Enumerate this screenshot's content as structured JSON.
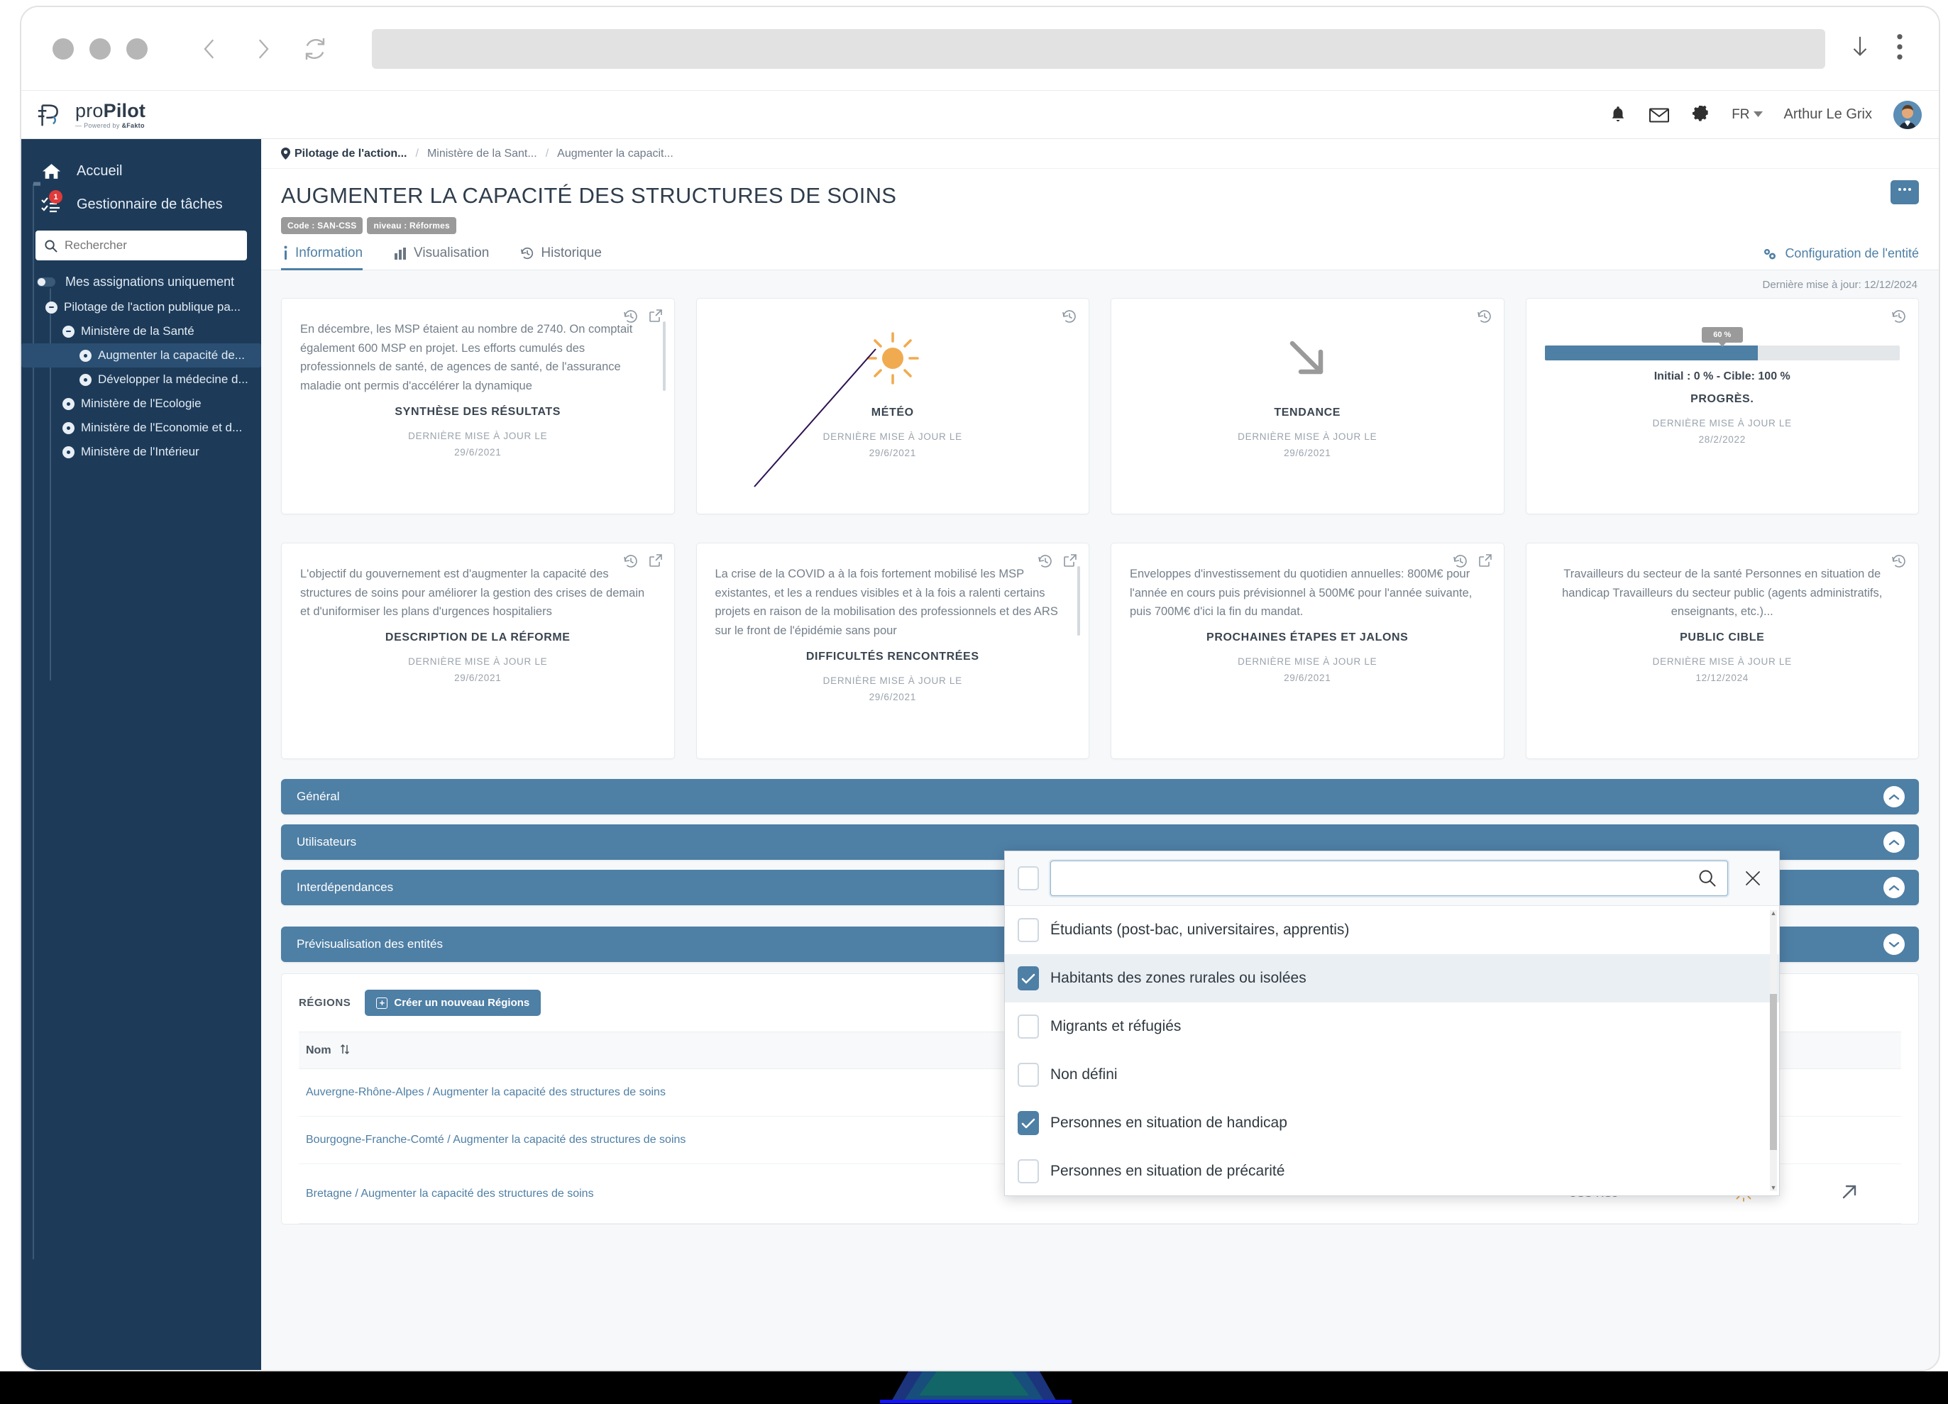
{
  "browser": {
    "back_icon": "chevron-left-icon",
    "forward_icon": "chevron-right-icon",
    "reload_icon": "reload-icon",
    "download_icon": "download-arrow-icon",
    "menu_icon": "kebab-menu-icon",
    "url_value": ""
  },
  "app_header": {
    "logo_title_light": "pro",
    "logo_title_bold": "Pilot",
    "logo_subtitle_pre": "— Powered by ",
    "logo_subtitle_bold": "&Fakto",
    "bell_icon": "bell-icon",
    "mail_icon": "mail-icon",
    "gear_icon": "gear-icon",
    "language": "FR",
    "user_name": "Arthur Le Grix"
  },
  "sidebar": {
    "home_label": "Accueil",
    "tasks_label": "Gestionnaire de tâches",
    "tasks_badge": "1",
    "search_placeholder": "Rechercher",
    "search_value": "",
    "toggle_label": "Mes assignations uniquement",
    "tree": [
      {
        "label": "Pilotage de l'action publique pa...",
        "level": 1,
        "expanded": true,
        "active": false
      },
      {
        "label": "Ministère de la Santé",
        "level": 2,
        "expanded": true,
        "active": false
      },
      {
        "label": "Augmenter la capacité de...",
        "level": 3,
        "expanded": false,
        "active": true
      },
      {
        "label": "Développer la médecine d...",
        "level": 3,
        "expanded": false,
        "active": false
      },
      {
        "label": "Ministère de l'Ecologie",
        "level": 2,
        "expanded": false,
        "active": false
      },
      {
        "label": "Ministère de l'Economie et d...",
        "level": 2,
        "expanded": false,
        "active": false
      },
      {
        "label": "Ministère de l'Intérieur",
        "level": 2,
        "expanded": false,
        "active": false
      }
    ]
  },
  "breadcrumb": {
    "pin_icon": "location-pin-icon",
    "items": [
      "Pilotage de l'action...",
      "Ministère de la Sant...",
      "Augmenter la capacit..."
    ]
  },
  "page": {
    "title": "AUGMENTER LA CAPACITÉ DES STRUCTURES DE SOINS",
    "badge_code": "Code : SAN-CSS",
    "badge_level": "niveau : Réformes",
    "more_button": "•••",
    "last_update": "Dernière mise à jour: 12/12/2024"
  },
  "tabs": [
    {
      "label": "Information",
      "icon": "info-icon",
      "active": true
    },
    {
      "label": "Visualisation",
      "icon": "chart-icon",
      "active": false
    },
    {
      "label": "Historique",
      "icon": "history-icon",
      "active": false
    }
  ],
  "config_link": {
    "label": "Configuration de l'entité",
    "icon": "gears-icon"
  },
  "cards_row1": [
    {
      "text": "En décembre, les MSP étaient au nombre de 2740. On comptait également 600 MSP en projet. Les efforts cumulés des professionnels de santé, de agences de santé, de l'assurance maladie ont permis d'accélérer la dynamique",
      "title": "SYNTHÈSE DES RÉSULTATS",
      "meta_label": "DERNIÈRE MISE À JOUR LE",
      "meta_date": "29/6/2021",
      "kind": "text",
      "has_history": true,
      "has_expand": true,
      "has_scroll": true
    },
    {
      "title": "MÉTÉO",
      "meta_label": "DERNIÈRE MISE À JOUR LE",
      "meta_date": "29/6/2021",
      "kind": "sun",
      "has_history": true,
      "has_expand": false
    },
    {
      "title": "TENDANCE",
      "meta_label": "DERNIÈRE MISE À JOUR LE",
      "meta_date": "29/6/2021",
      "kind": "arrow-down-right",
      "has_history": true,
      "has_expand": false
    },
    {
      "title": "PROGRÈS.",
      "meta_label": "DERNIÈRE MISE À JOUR LE",
      "meta_date": "28/2/2022",
      "kind": "progress",
      "progress_value": "60 %",
      "progress_pct": 60,
      "progress_range": "Initial : 0 % - Cible: 100 %",
      "has_history": true,
      "has_expand": false
    }
  ],
  "cards_row2": [
    {
      "text": "L'objectif du gouvernement est d'augmenter la capacité des structures de soins pour améliorer la gestion des crises de demain et d'uniformiser les plans d'urgences hospitaliers",
      "title": "DESCRIPTION DE LA RÉFORME",
      "meta_label": "DERNIÈRE MISE À JOUR LE",
      "meta_date": "29/6/2021",
      "kind": "text",
      "has_history": true,
      "has_expand": true,
      "has_scroll": false
    },
    {
      "text": "La crise de la COVID a à la fois fortement mobilisé les MSP existantes, et les a rendues visibles et à la fois a ralenti certains projets en raison de la mobilisation des professionnels et des ARS sur le front de l'épidémie sans pour",
      "title": "DIFFICULTÉS RENCONTRÉES",
      "meta_label": "DERNIÈRE MISE À JOUR LE",
      "meta_date": "29/6/2021",
      "kind": "text",
      "has_history": true,
      "has_expand": true,
      "has_scroll": true
    },
    {
      "text": "Enveloppes d'investissement du quotidien annuelles: 800M€ pour l'année en cours puis prévisionnel à 500M€ pour l'année suivante, puis 700M€ d'ici la fin du mandat.",
      "title": "PROCHAINES ÉTAPES ET JALONS",
      "meta_label": "DERNIÈRE MISE À JOUR LE",
      "meta_date": "29/6/2021",
      "kind": "text",
      "has_history": true,
      "has_expand": true,
      "has_scroll": false
    },
    {
      "text": "Travailleurs du secteur de la santé\nPersonnes en situation de handicap\nTravailleurs du secteur public (agents administratifs, enseignants, etc.)...",
      "title": "PUBLIC CIBLE",
      "meta_label": "DERNIÈRE MISE À JOUR LE",
      "meta_date": "12/12/2024",
      "kind": "text-center",
      "has_history": true,
      "has_expand": false,
      "has_scroll": false
    }
  ],
  "accordions": [
    {
      "label": "Général",
      "expanded": true
    },
    {
      "label": "Utilisateurs",
      "expanded": true
    },
    {
      "label": "Interdépendances",
      "expanded": true
    },
    {
      "label": "Prévisualisation des entités",
      "expanded": false
    }
  ],
  "region_panel": {
    "section_label": "RÉGIONS",
    "create_label": "Créer un nouveau Régions",
    "columns": [
      "Nom"
    ],
    "sort_icon": "sort-icon",
    "rows": [
      {
        "name": "Auvergne-Rhône-Alpes / Augmenter la capacité des structures de soins",
        "code": "",
        "weather": "",
        "link": ""
      },
      {
        "name": "Bourgogne-Franche-Comté / Augmenter la capacité des structures de soins",
        "code": "",
        "weather": "",
        "link": ""
      },
      {
        "name": "Bretagne / Augmenter la capacité des structures de soins",
        "code": "CSS-RS3",
        "weather": "sun-icon",
        "link": "arrow-up-right-icon"
      }
    ]
  },
  "popup": {
    "search_value": "",
    "search_placeholder": "",
    "search_icon": "search-icon",
    "close_icon": "close-icon",
    "select_all_checked": false,
    "options": [
      {
        "label": "Étudiants (post-bac, universitaires, apprentis)",
        "checked": false,
        "highlighted": false
      },
      {
        "label": "Habitants des zones rurales ou isolées",
        "checked": true,
        "highlighted": true
      },
      {
        "label": "Migrants et réfugiés",
        "checked": false,
        "highlighted": false
      },
      {
        "label": "Non défini",
        "checked": false,
        "highlighted": false
      },
      {
        "label": "Personnes en situation de handicap",
        "checked": true,
        "highlighted": false
      },
      {
        "label": "Personnes en situation de précarité",
        "checked": false,
        "highlighted": false
      }
    ]
  },
  "colors": {
    "brand_blue": "#4e7fa5",
    "sidebar_navy": "#1d3b59",
    "sun_orange": "#f0ab50",
    "badge_red": "#e03a3a"
  }
}
